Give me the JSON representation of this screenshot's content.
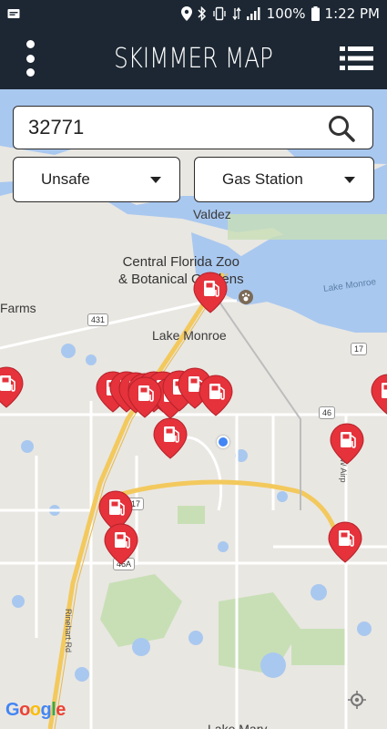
{
  "status_bar": {
    "battery": "100%",
    "time": "1:22 PM",
    "icons": [
      "notification-icon",
      "location-icon",
      "bluetooth-icon",
      "vibrate-icon",
      "data-icon",
      "signal-icon",
      "battery-icon"
    ]
  },
  "header": {
    "title": "SKIMMER MAP",
    "menu_icon": "more-vertical-icon",
    "list_icon": "list-icon"
  },
  "search": {
    "value": "32771",
    "placeholder": "",
    "button_icon": "search-icon"
  },
  "filters": {
    "safety": {
      "selected": "Unsafe"
    },
    "type": {
      "selected": "Gas Station"
    }
  },
  "map": {
    "labels": {
      "valdez": "Valdez",
      "zoo": "Central Florida Zoo\n& Botanical Gardens",
      "lake_monroe_lake": "Lake Monroe",
      "lake_monroe_town": "Lake Monroe",
      "farms": "Farms",
      "lake_mary": "Lake Mary",
      "rinehart": "Rinehart Rd",
      "w_airport": "W Airp"
    },
    "shields": {
      "r431": "431",
      "r17a": "17",
      "r46": "46",
      "r17b": "17",
      "r46a": "46A"
    },
    "colors": {
      "pin": "#e5323b",
      "water": "#a9c8ef",
      "park": "#c8dfb6",
      "road_major": "#f3c95d",
      "road": "#ffffff",
      "header_bg": "#1c2733"
    },
    "pin_count": 19,
    "attribution": "Google"
  }
}
